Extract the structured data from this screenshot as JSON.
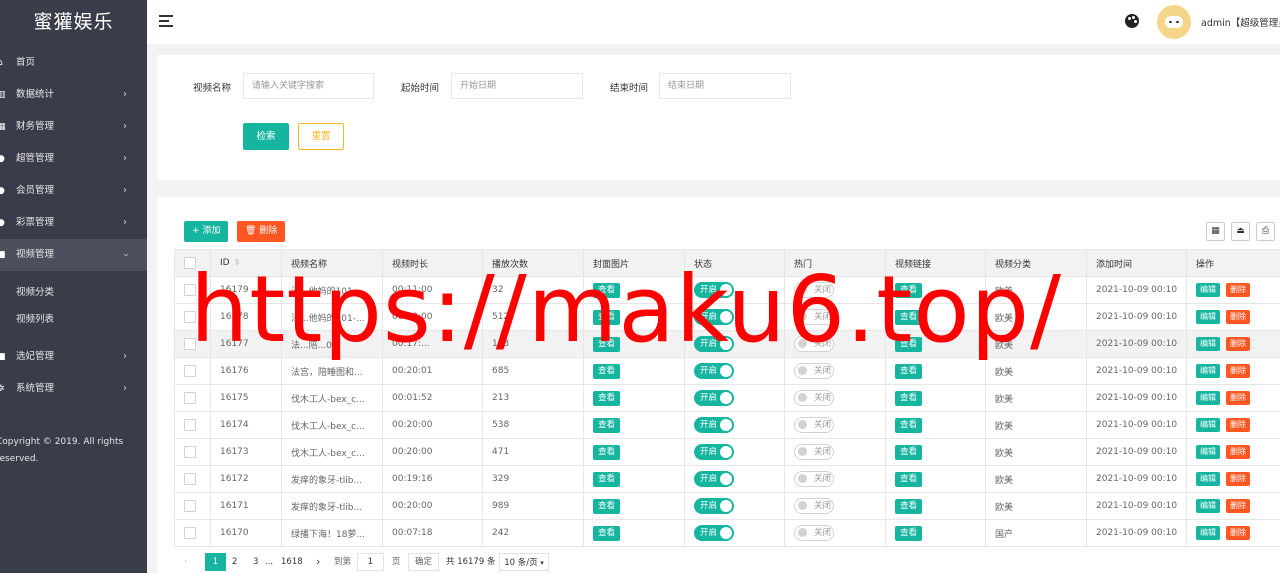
{
  "app": {
    "logo": "蜜獾娱乐"
  },
  "sidebar": {
    "items": [
      {
        "label": "首页",
        "icon": "home-icon",
        "arrow": ""
      },
      {
        "label": "数据统计",
        "icon": "chart-icon",
        "arrow": "›"
      },
      {
        "label": "财务管理",
        "icon": "bank-icon",
        "arrow": "›"
      },
      {
        "label": "超管管理",
        "icon": "user-icon",
        "arrow": "›"
      },
      {
        "label": "会员管理",
        "icon": "users-icon",
        "arrow": "›"
      },
      {
        "label": "彩票管理",
        "icon": "ticket-icon",
        "arrow": "›"
      },
      {
        "label": "视频管理",
        "icon": "video-icon",
        "arrow": "›"
      }
    ],
    "sub_items": [
      {
        "label": "视频分类"
      },
      {
        "label": "视频列表"
      }
    ],
    "items_after": [
      {
        "label": "选妃管理",
        "icon": "heart-icon",
        "arrow": "›"
      },
      {
        "label": "系统管理",
        "icon": "gear-icon",
        "arrow": "›"
      }
    ],
    "copyright_1": "Copyright © 2019. All rights",
    "copyright_2": "reserved."
  },
  "header": {
    "user": "admin【超级管理员】"
  },
  "search": {
    "name_label": "视频名称",
    "name_placeholder": "请输入关键字搜索",
    "start_label": "起始时间",
    "start_placeholder": "开始日期",
    "end_label": "结束时间",
    "end_placeholder": "结束日期",
    "search_btn": "检索",
    "reset_btn": "重置"
  },
  "toolbar": {
    "add": "+ 添加",
    "delete": "删除"
  },
  "table": {
    "headers": [
      "ID",
      "视频名称",
      "视频时长",
      "播放次数",
      "封面图片",
      "状态",
      "热门",
      "视频链接",
      "视频分类",
      "添加时间",
      "操作"
    ],
    "view_label": "查看",
    "on_label": "开启",
    "off_label": "关闭",
    "edit_label": "编辑",
    "del_label": "删除",
    "rows": [
      {
        "id": "16179",
        "name": "法...他妈的101-...",
        "duration": "00:11:00",
        "plays": "32",
        "category": "欧美",
        "added": "2021-10-09 00:10"
      },
      {
        "id": "16178",
        "name": "法...他妈的101-...",
        "duration": "00:20:00",
        "plays": "512",
        "category": "欧美",
        "added": "2021-10-09 00:10"
      },
      {
        "id": "16177",
        "name": "法...陪...0...",
        "duration": "00:17:...",
        "plays": "143",
        "category": "欧美",
        "added": "2021-10-09 00:10"
      },
      {
        "id": "16176",
        "name": "法宫，陪睡图和...",
        "duration": "00:20:01",
        "plays": "685",
        "category": "欧美",
        "added": "2021-10-09 00:10"
      },
      {
        "id": "16175",
        "name": "伐木工人-bex_c...",
        "duration": "00:01:52",
        "plays": "213",
        "category": "欧美",
        "added": "2021-10-09 00:10"
      },
      {
        "id": "16174",
        "name": "伐木工人-bex_c...",
        "duration": "00:20:00",
        "plays": "538",
        "category": "欧美",
        "added": "2021-10-09 00:10"
      },
      {
        "id": "16173",
        "name": "伐木工人-bex_c...",
        "duration": "00:20:00",
        "plays": "471",
        "category": "欧美",
        "added": "2021-10-09 00:10"
      },
      {
        "id": "16172",
        "name": "发痒的象牙-tlib...",
        "duration": "00:19:16",
        "plays": "329",
        "category": "欧美",
        "added": "2021-10-09 00:10"
      },
      {
        "id": "16171",
        "name": "发痒的象牙-tlib...",
        "duration": "00:20:00",
        "plays": "989",
        "category": "欧美",
        "added": "2021-10-09 00:10"
      },
      {
        "id": "16170",
        "name": "绿播下海！18萝...",
        "duration": "00:07:18",
        "plays": "242",
        "category": "国产",
        "added": "2021-10-09 00:10"
      }
    ]
  },
  "pagination": {
    "prev": "‹",
    "p1": "1",
    "p2": "2",
    "p3": "3",
    "ellipsis": "...",
    "last": "1618",
    "next": "›",
    "goto_label": "到第",
    "goto_value": "1",
    "page_unit": "页",
    "confirm": "确定",
    "total": "共 16179 条",
    "per_page": "10 条/页"
  },
  "watermark": "https://maku6.top/",
  "colors": {
    "accent": "#16b5a0",
    "danger": "#ff5722",
    "warning": "#f7b824",
    "sidebar": "#393d49"
  }
}
